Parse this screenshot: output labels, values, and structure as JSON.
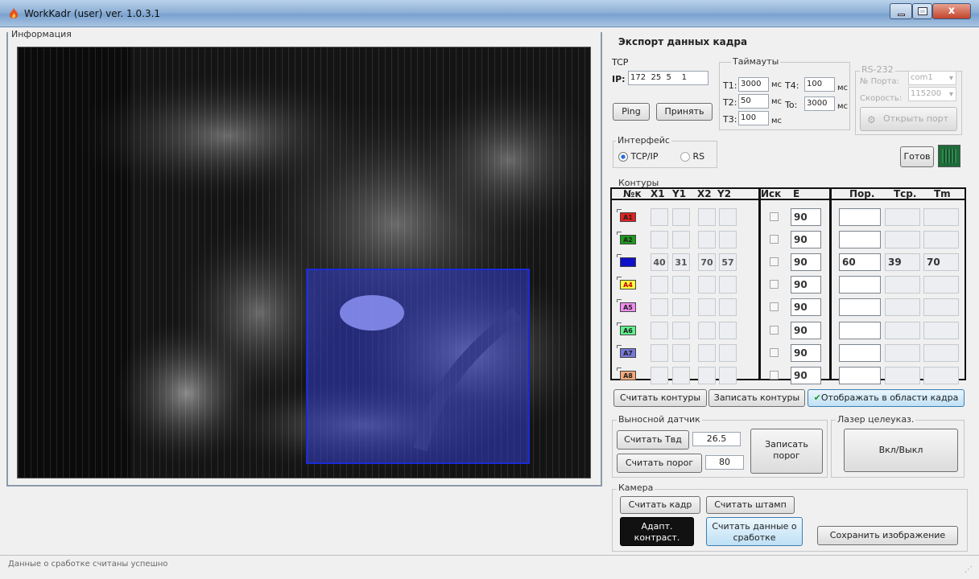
{
  "window": {
    "title": "WorkKadr (user) ver. 1.0.3.1",
    "close_label": "x"
  },
  "info": {
    "legend": "Информация"
  },
  "export": {
    "title": "Экспорт данных кадра"
  },
  "tcp": {
    "label": "TCP",
    "ip_label": "IP:",
    "ip": [
      "172",
      "25",
      "5",
      "1"
    ],
    "ping_label": "Ping",
    "accept_label": "Принять"
  },
  "timeouts": {
    "legend": "Таймауты",
    "t1_label": "T1:",
    "t1": "3000",
    "t2_label": "T2:",
    "t2": "50",
    "t3_label": "T3:",
    "t3": "100",
    "t4_label": "T4:",
    "t4": "100",
    "to_label": "To:",
    "to": "3000",
    "unit": "мс"
  },
  "rs232": {
    "legend": "RS-232",
    "port_label": "№ Порта:",
    "port": "com1",
    "speed_label": "Скорость:",
    "speed": "115200",
    "open_label": "Открыть порт"
  },
  "interface": {
    "legend": "Интерфейс",
    "tcp_label": "TCP/IP",
    "rs_label": "RS",
    "selected": "TCP/IP"
  },
  "ready": {
    "label": "Готов"
  },
  "contours": {
    "legend": "Контуры",
    "headers": {
      "nk": "№к",
      "x1": "X1",
      "y1": "Y1",
      "x2": "X2",
      "y2": "Y2",
      "isk": "Иск",
      "e": "E",
      "por": "Пор.",
      "tsr": "Тср.",
      "tm": "Tm"
    },
    "rows": [
      {
        "name": "A1",
        "color": "#e02020",
        "x1": "",
        "y1": "",
        "x2": "",
        "y2": "",
        "e": "90",
        "por": "",
        "tsr": "",
        "tm": ""
      },
      {
        "name": "A2",
        "color": "#1d9a1d",
        "x1": "",
        "y1": "",
        "x2": "",
        "y2": "",
        "e": "90",
        "por": "",
        "tsr": "",
        "tm": ""
      },
      {
        "name": "",
        "color": "#1010c8",
        "x1": "40",
        "y1": "31",
        "x2": "70",
        "y2": "57",
        "e": "90",
        "por": "60",
        "tsr": "39",
        "tm": "70"
      },
      {
        "name": "A4",
        "color": "#ffff40",
        "x1": "",
        "y1": "",
        "x2": "",
        "y2": "",
        "e": "90",
        "por": "",
        "tsr": "",
        "tm": ""
      },
      {
        "name": "A5",
        "color": "#f08cf0",
        "x1": "",
        "y1": "",
        "x2": "",
        "y2": "",
        "e": "90",
        "por": "",
        "tsr": "",
        "tm": ""
      },
      {
        "name": "A6",
        "color": "#5ff08c",
        "x1": "",
        "y1": "",
        "x2": "",
        "y2": "",
        "e": "90",
        "por": "",
        "tsr": "",
        "tm": ""
      },
      {
        "name": "A7",
        "color": "#7878d8",
        "x1": "",
        "y1": "",
        "x2": "",
        "y2": "",
        "e": "90",
        "por": "",
        "tsr": "",
        "tm": ""
      },
      {
        "name": "A8",
        "color": "#f3a878",
        "x1": "",
        "y1": "",
        "x2": "",
        "y2": "",
        "e": "90",
        "por": "",
        "tsr": "",
        "tm": ""
      }
    ],
    "read_label": "Считать контуры",
    "write_label": "Записать контуры",
    "show_label": "Отображать в области кадра"
  },
  "sensor": {
    "legend": "Выносной датчик",
    "read_t_label": "Считать Твд",
    "t_value": "26.5",
    "read_thr_label": "Считать порог",
    "thr_value": "80",
    "write_thr_label": "Записать порог"
  },
  "laser": {
    "legend": "Лазер целеуказ.",
    "toggle_label": "Вкл/Выкл"
  },
  "camera": {
    "legend": "Камера",
    "read_frame_label": "Считать кадр",
    "read_stamp_label": "Считать штамп",
    "adapt_label": "Адапт. контраст.",
    "read_trigger_label": "Считать данные о сработке",
    "save_image_label": "Сохранить изображение"
  },
  "status": {
    "text": "Данные о сработке считаны успешно"
  },
  "colors": {
    "accent": "#1a2bd6",
    "frame_bg": "#111111"
  }
}
